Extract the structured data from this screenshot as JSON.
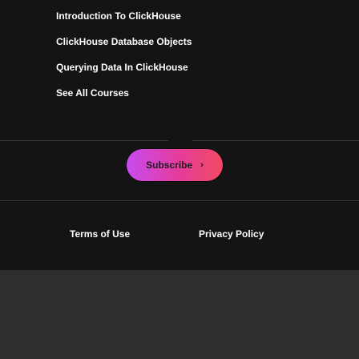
{
  "courses": {
    "items": [
      {
        "label": "Introduction To ClickHouse"
      },
      {
        "label": "ClickHouse Database Objects"
      },
      {
        "label": "Querying Data In ClickHouse"
      },
      {
        "label": "See All Courses"
      }
    ]
  },
  "subscribe": {
    "label": "Subscribe",
    "icon": "chevron-right-icon",
    "chevron": "›"
  },
  "legal": {
    "terms_label": "Terms of Use",
    "privacy_label": "Privacy Policy"
  },
  "colors": {
    "footer_bg": "#141414",
    "page_bg": "#2f2f2f",
    "accent_gradient_start": "#c84bf0",
    "accent_gradient_end": "#f24a62"
  }
}
